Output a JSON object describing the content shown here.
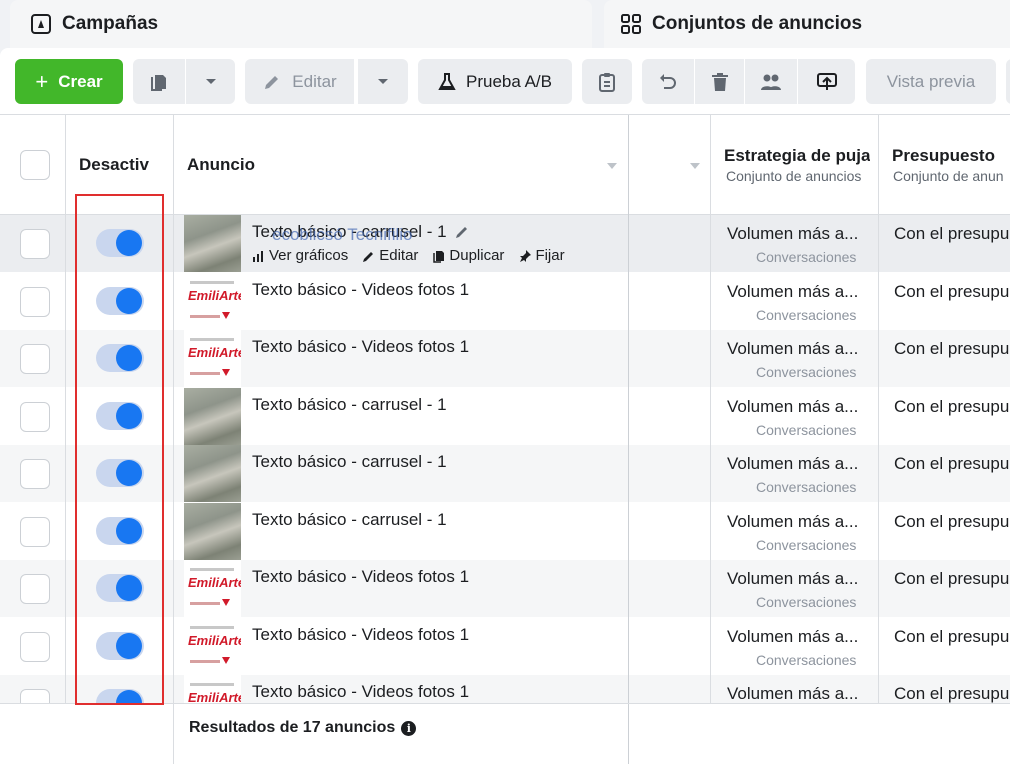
{
  "tabs": {
    "campaigns": "Campañas",
    "adsets": "Conjuntos de anuncios"
  },
  "toolbar": {
    "create": "Crear",
    "edit": "Editar",
    "ab_test": "Prueba A/B",
    "preview": "Vista previa"
  },
  "header": {
    "off_col": "Desactiv",
    "ad_col": "Anuncio",
    "bid_col": "Estrategia de puja",
    "bid_sub": "Conjunto de anuncios",
    "budget_col": "Presupuesto",
    "budget_sub": "Conjunto de anun"
  },
  "hover_actions": {
    "charts": "Ver gráficos",
    "edit": "Editar",
    "duplicate": "Duplicar",
    "pin": "Fijar",
    "ghost_text": "ecoblicsó Tecnifilio"
  },
  "rows": [
    {
      "name": "Texto básico - carrusel - 1",
      "thumb": "photo",
      "bid": "Volumen más a...",
      "bid_sub": "Conversaciones",
      "budget": "Con el presupu"
    },
    {
      "name": "Texto básico - Videos fotos 1",
      "thumb": "brand",
      "bid": "Volumen más a...",
      "bid_sub": "Conversaciones",
      "budget": "Con el presupu"
    },
    {
      "name": "Texto básico - Videos fotos 1",
      "thumb": "brand",
      "bid": "Volumen más a...",
      "bid_sub": "Conversaciones",
      "budget": "Con el presupu"
    },
    {
      "name": "Texto básico - carrusel - 1",
      "thumb": "photo",
      "bid": "Volumen más a...",
      "bid_sub": "Conversaciones",
      "budget": "Con el presupu"
    },
    {
      "name": "Texto básico - carrusel - 1",
      "thumb": "photo",
      "bid": "Volumen más a...",
      "bid_sub": "Conversaciones",
      "budget": "Con el presupu"
    },
    {
      "name": "Texto básico - carrusel - 1",
      "thumb": "photo",
      "bid": "Volumen más a...",
      "bid_sub": "Conversaciones",
      "budget": "Con el presupu"
    },
    {
      "name": "Texto básico - Videos fotos 1",
      "thumb": "brand",
      "bid": "Volumen más a...",
      "bid_sub": "Conversaciones",
      "budget": "Con el presupu"
    },
    {
      "name": "Texto básico - Videos fotos 1",
      "thumb": "brand",
      "bid": "Volumen más a...",
      "bid_sub": "Conversaciones",
      "budget": "Con el presupu"
    },
    {
      "name": "Texto básico - Videos fotos 1",
      "thumb": "brand",
      "bid": "Volumen más a...",
      "bid_sub": "",
      "budget": "Con el presupu"
    }
  ],
  "brand_logo": "EmiliArte",
  "footer": {
    "results": "Resultados de 17 anuncios"
  },
  "colors": {
    "create_green": "#42b72a",
    "toggle_blue": "#1877f2",
    "highlight_red": "#e02e2e"
  }
}
